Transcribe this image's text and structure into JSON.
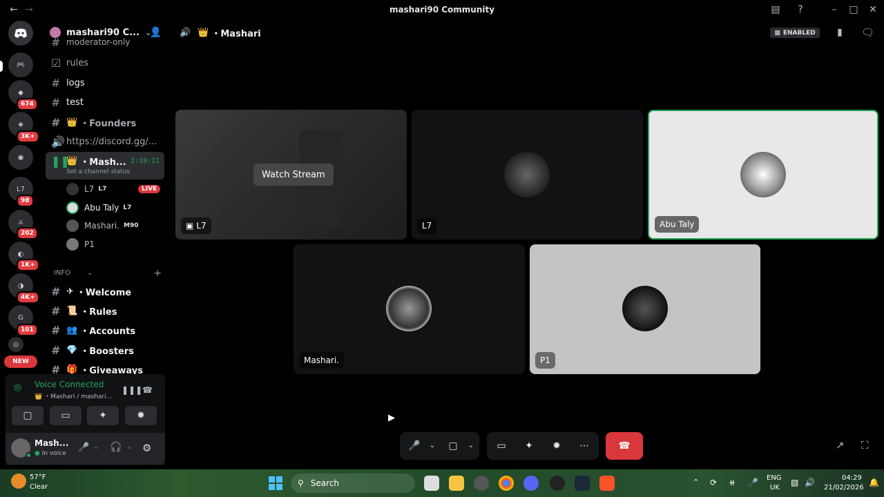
{
  "window": {
    "title": "mashari90 Community"
  },
  "server": {
    "name": "mashari90 C..."
  },
  "channels": {
    "cut_top": "moderator-only",
    "rules": "rules",
    "logs": "logs",
    "test": "test",
    "founders": "・Founders",
    "invite": "https://discord.gg/...",
    "voice_name": "・Mash...",
    "voice_timer": "2:10:21",
    "voice_status": "Set a channel status"
  },
  "members": [
    {
      "name": "L7",
      "tag": "L7",
      "live": "LIVE"
    },
    {
      "name": "Abu Taly",
      "tag": "L7"
    },
    {
      "name": "Mashari.",
      "tag": "M90"
    },
    {
      "name": "P1"
    }
  ],
  "info_category": {
    "label": "INFO",
    "items": [
      "・Welcome",
      "・Rules",
      "・Accounts",
      "・Boosters",
      "・Giveaways"
    ]
  },
  "servers": {
    "badges": [
      "674",
      "3K+",
      "98",
      "202",
      "1K+",
      "4K+",
      "101"
    ],
    "new_label": "NEW"
  },
  "voice": {
    "status": "Voice Connected",
    "location": "・Mashari / mashari..."
  },
  "user": {
    "name": "Mash...",
    "status": "In voice"
  },
  "stage": {
    "channel_name": "・Mashari",
    "enabled_label": "ENABLED",
    "watch_stream": "Watch Stream",
    "tiles": [
      "L7",
      "L7",
      "Abu Taly",
      "Mashari.",
      "P1"
    ]
  },
  "taskbar": {
    "weather_temp": "57°F",
    "weather_desc": "Clear",
    "search_placeholder": "Search",
    "lang_top": "ENG",
    "lang_bottom": "UK",
    "time": "04:29",
    "date": "21/02/2026"
  },
  "colors": {
    "voice_green": "#23a55a",
    "danger_red": "#da373c",
    "blurple": "#5865f2"
  },
  "icons": [
    "back-arrow-icon",
    "forward-arrow-icon",
    "inbox-icon",
    "help-icon",
    "minimize-icon",
    "maximize-icon",
    "close-icon",
    "speaker-icon",
    "crown-icon",
    "bookmark-icon",
    "chat-icon",
    "mic-icon",
    "camera-off-icon",
    "screenshare-icon",
    "activity-icon",
    "soundboard-icon",
    "more-icon",
    "hangup-icon",
    "popout-icon",
    "fullscreen-icon",
    "headphones-icon",
    "gear-icon"
  ]
}
